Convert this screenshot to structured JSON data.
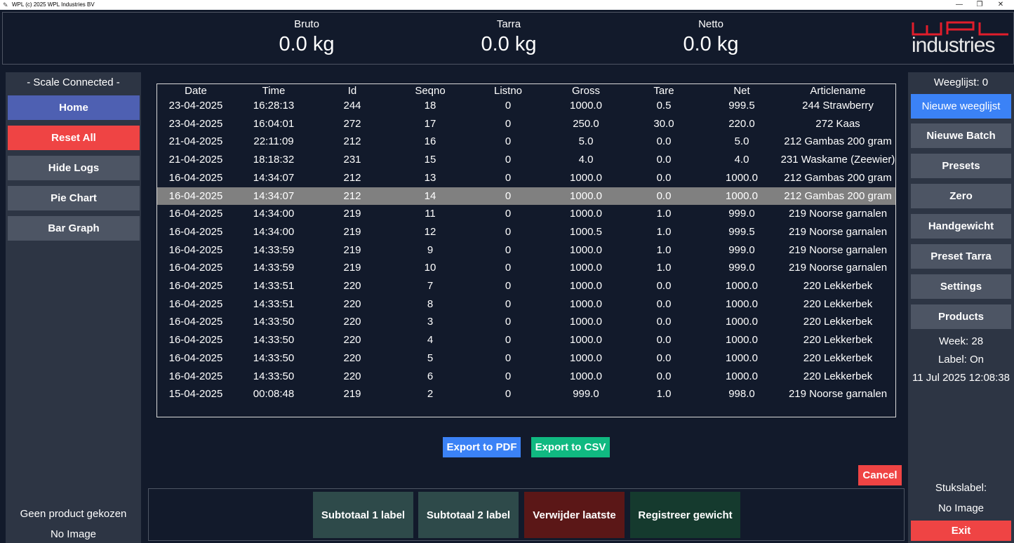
{
  "window": {
    "title": "WPL (c) 2025 WPL Industries BV",
    "minimize": "—",
    "maximize": "❐",
    "close": "✕"
  },
  "header": {
    "bruto_label": "Bruto",
    "bruto_value": "0.0 kg",
    "tarra_label": "Tarra",
    "tarra_value": "0.0 kg",
    "netto_label": "Netto",
    "netto_value": "0.0 kg",
    "logo_text": "industries",
    "logo_mark": "WPL",
    "logo_color": "#e11d2b"
  },
  "left_sidebar": {
    "status": "- Scale Connected -",
    "home": "Home",
    "reset_all": "Reset All",
    "hide_logs": "Hide Logs",
    "pie_chart": "Pie Chart",
    "bar_graph": "Bar Graph",
    "product_status": "Geen product gekozen",
    "product_image": "No Image"
  },
  "table": {
    "columns": [
      "Date",
      "Time",
      "Id",
      "Seqno",
      "Listno",
      "Gross",
      "Tare",
      "Net",
      "Articlename"
    ],
    "selected_row": 5,
    "rows": [
      [
        "23-04-2025",
        "16:28:13",
        "244",
        "18",
        "0",
        "1000.0",
        "0.5",
        "999.5",
        "244 Strawberry"
      ],
      [
        "23-04-2025",
        "16:04:01",
        "272",
        "17",
        "0",
        "250.0",
        "30.0",
        "220.0",
        "272 Kaas"
      ],
      [
        "21-04-2025",
        "22:11:09",
        "212",
        "16",
        "0",
        "5.0",
        "0.0",
        "5.0",
        "212 Gambas 200 gram"
      ],
      [
        "21-04-2025",
        "18:18:32",
        "231",
        "15",
        "0",
        "4.0",
        "0.0",
        "4.0",
        "231 Waskame (Zeewier)"
      ],
      [
        "16-04-2025",
        "14:34:07",
        "212",
        "13",
        "0",
        "1000.0",
        "0.0",
        "1000.0",
        "212 Gambas 200 gram"
      ],
      [
        "16-04-2025",
        "14:34:07",
        "212",
        "14",
        "0",
        "1000.0",
        "0.0",
        "1000.0",
        "212 Gambas 200 gram"
      ],
      [
        "16-04-2025",
        "14:34:00",
        "219",
        "11",
        "0",
        "1000.0",
        "1.0",
        "999.0",
        "219 Noorse garnalen"
      ],
      [
        "16-04-2025",
        "14:34:00",
        "219",
        "12",
        "0",
        "1000.5",
        "1.0",
        "999.5",
        "219 Noorse garnalen"
      ],
      [
        "16-04-2025",
        "14:33:59",
        "219",
        "9",
        "0",
        "1000.0",
        "1.0",
        "999.0",
        "219 Noorse garnalen"
      ],
      [
        "16-04-2025",
        "14:33:59",
        "219",
        "10",
        "0",
        "1000.0",
        "1.0",
        "999.0",
        "219 Noorse garnalen"
      ],
      [
        "16-04-2025",
        "14:33:51",
        "220",
        "7",
        "0",
        "1000.0",
        "0.0",
        "1000.0",
        "220 Lekkerbek"
      ],
      [
        "16-04-2025",
        "14:33:51",
        "220",
        "8",
        "0",
        "1000.0",
        "0.0",
        "1000.0",
        "220 Lekkerbek"
      ],
      [
        "16-04-2025",
        "14:33:50",
        "220",
        "3",
        "0",
        "1000.0",
        "0.0",
        "1000.0",
        "220 Lekkerbek"
      ],
      [
        "16-04-2025",
        "14:33:50",
        "220",
        "4",
        "0",
        "1000.0",
        "0.0",
        "1000.0",
        "220 Lekkerbek"
      ],
      [
        "16-04-2025",
        "14:33:50",
        "220",
        "5",
        "0",
        "1000.0",
        "0.0",
        "1000.0",
        "220 Lekkerbek"
      ],
      [
        "16-04-2025",
        "14:33:50",
        "220",
        "6",
        "0",
        "1000.0",
        "0.0",
        "1000.0",
        "220 Lekkerbek"
      ],
      [
        "15-04-2025",
        "00:08:48",
        "219",
        "2",
        "0",
        "999.0",
        "1.0",
        "998.0",
        "219 Noorse garnalen"
      ]
    ]
  },
  "export": {
    "pdf": "Export to PDF",
    "csv": "Export to CSV",
    "pdf_color": "#3b82f6",
    "csv_color": "#10b981"
  },
  "cancel": "Cancel",
  "actions": {
    "subtotal1": "Subtotaal 1 label",
    "subtotal2": "Subtotaal 2 label",
    "remove_last": "Verwijder laatste",
    "register": "Registreer gewicht"
  },
  "right_sidebar": {
    "weeglijst": "Weeglijst: 0",
    "nieuwe_weeglijst": "Nieuwe weeglijst",
    "nieuwe_batch": "Nieuwe Batch",
    "presets": "Presets",
    "zero": "Zero",
    "handgewicht": "Handgewicht",
    "preset_tarra": "Preset Tarra",
    "settings": "Settings",
    "products": "Products",
    "week": "Week: 28",
    "label": "Label: On",
    "datetime": "11 Jul 2025 12:08:38",
    "stukslabel": "Stukslabel:",
    "stukslabel_image": "No Image",
    "exit": "Exit"
  }
}
